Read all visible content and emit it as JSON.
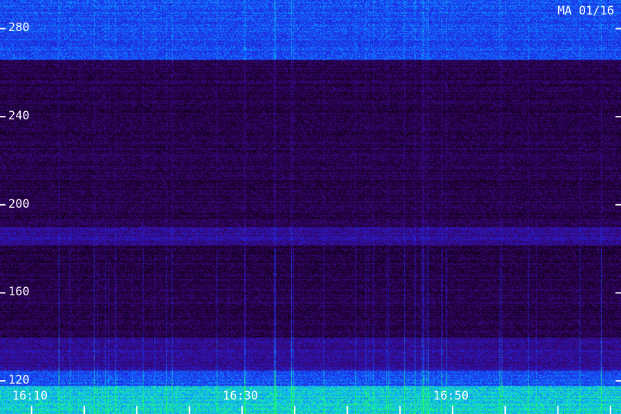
{
  "title": "MA 01/16",
  "chart_data": {
    "type": "heatmap",
    "title": "MA 01/16",
    "xlabel": "",
    "ylabel": "",
    "y_ticks": [
      120,
      160,
      200,
      240,
      280
    ],
    "y_tick_labels": [
      "120",
      "160",
      "200",
      "240",
      "280"
    ],
    "ylim": [
      105,
      293
    ],
    "x_ticks": [
      "16:10",
      "16:30",
      "16:50"
    ],
    "x_tick_labels": [
      "16:10",
      "16:30",
      "16:50"
    ],
    "xlim": [
      "16:07",
      "16:66"
    ],
    "x_minor_tick_minutes": 5,
    "colormap": [
      "#000000",
      "#2a0046",
      "#3a0a8a",
      "#2020e0",
      "#1060ff",
      "#10c8ff",
      "#20ff60"
    ],
    "bright_bands": [
      {
        "y": [
          266,
          293
        ],
        "level": 0.6
      },
      {
        "y": [
          105,
          118
        ],
        "level": 0.85
      },
      {
        "y": [
          118,
          125
        ],
        "level": 0.6
      },
      {
        "y": [
          125,
          140
        ],
        "level": 0.35
      },
      {
        "y": [
          182,
          190
        ],
        "level": 0.35
      }
    ]
  }
}
